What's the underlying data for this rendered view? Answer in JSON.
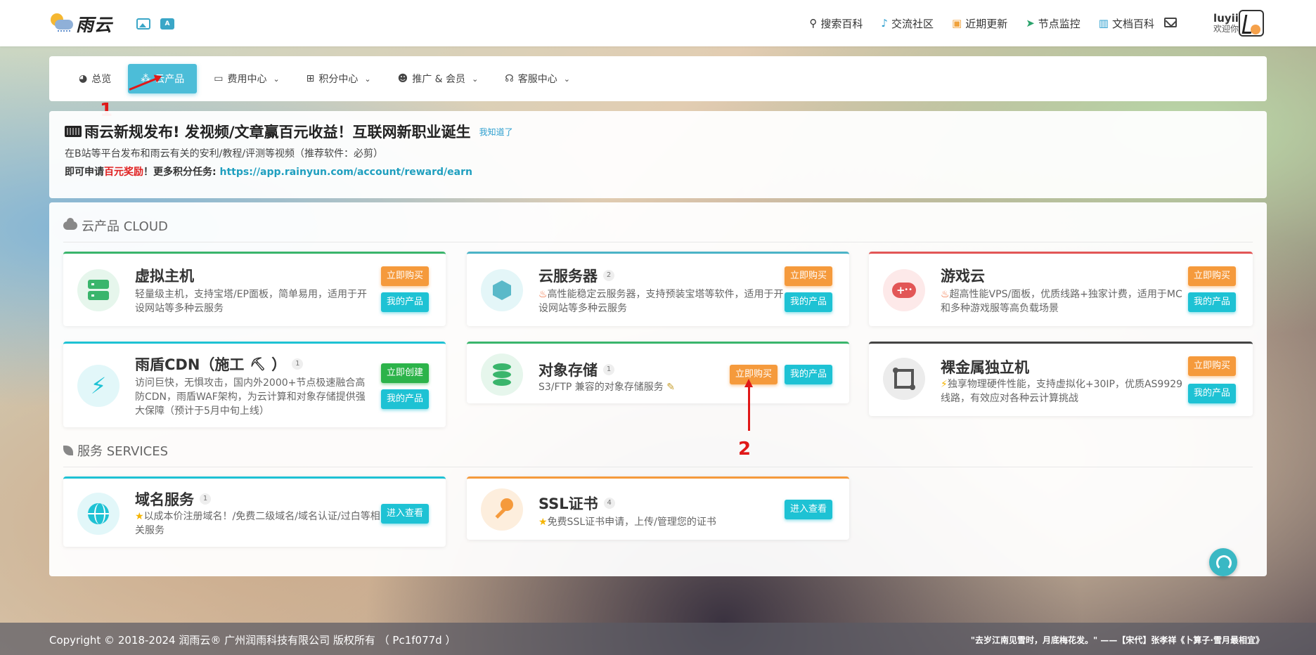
{
  "app": {
    "logo_text": "雨云"
  },
  "topnav": {
    "items": [
      {
        "label": "搜索百科",
        "icon": "search-icon"
      },
      {
        "label": "交流社区",
        "icon": "bell-icon"
      },
      {
        "label": "近期更新",
        "icon": "update-icon"
      },
      {
        "label": "节点监控",
        "icon": "location-arrow-icon"
      },
      {
        "label": "文档百科",
        "icon": "book-icon"
      }
    ],
    "user_name": "luyii",
    "user_greeting": "欢迎你"
  },
  "menu": {
    "items": [
      {
        "label": "总览",
        "icon": "dashboard-icon",
        "active": false
      },
      {
        "label": "云产品",
        "icon": "cubes-icon",
        "active": true
      },
      {
        "label": "费用中心",
        "icon": "money-icon",
        "active": false
      },
      {
        "label": "积分中心",
        "icon": "gift-icon",
        "active": false
      },
      {
        "label": "推广 & 会员",
        "icon": "users-icon",
        "active": false
      },
      {
        "label": "客服中心",
        "icon": "headset-icon",
        "active": false
      }
    ]
  },
  "announcement": {
    "title": "雨云新规发布! 发视频/文章赢百元收益！互联网新职业诞生",
    "link": "我知道了",
    "line1": "在B站等平台发布和雨云有关的安利/教程/评测等视频（推荐软件：必剪）",
    "line2_a": "即可申请",
    "line2_red": "百元奖励",
    "line2_b": "！更多积分任务: ",
    "line2_url": "https://app.rainyun.com/account/reward/earn"
  },
  "sections": {
    "cloud_title": "云产品 CLOUD",
    "services_title": "服务 SERVICES"
  },
  "cards": {
    "vhost": {
      "name": "虚拟主机",
      "desc": "轻量级主机，支持宝塔/EP面板，简单易用，适用于开设网站等多种云服务",
      "btn1": "立即购买",
      "btn2": "我的产品"
    },
    "ecs": {
      "name": "云服务器",
      "badge": "2",
      "desc": "高性能稳定云服务器，支持预装宝塔等软件，适用于开设网站等多种云服务",
      "btn1": "立即购买",
      "btn2": "我的产品"
    },
    "game": {
      "name": "游戏云",
      "desc": "超高性能VPS/面板，优质线路+独家计费，适用于MC和多种游戏服等高负载场景",
      "btn1": "立即购买",
      "btn2": "我的产品"
    },
    "cdn": {
      "name": "雨盾CDN（施工",
      "name_suffix": "）",
      "badge": "1",
      "desc": "访问巨快，无惧攻击，国内外2000+节点极速融合高防CDN，雨盾WAF架构，为云计算和对象存储提供强大保障（预计于5月中旬上线）",
      "btn1": "立即创建",
      "btn2": "我的产品"
    },
    "oss": {
      "name": "对象存储",
      "badge": "1",
      "desc": "S3/FTP 兼容的对象存储服务",
      "btn1": "立即购买",
      "btn2": "我的产品"
    },
    "baremetal": {
      "name": "裸金属独立机",
      "desc": "独享物理硬件性能，支持虚拟化+30IP，优质AS9929线路，有效应对各种云计算挑战",
      "btn1": "立即购买",
      "btn2": "我的产品"
    },
    "domain": {
      "name": "域名服务",
      "badge": "1",
      "desc": "以成本价注册域名！/免费二级域名/域名认证/过白等相关服务",
      "btn": "进入查看"
    },
    "ssl": {
      "name": "SSL证书",
      "badge": "4",
      "desc": "免费SSL证书申请，上传/管理您的证书",
      "btn": "进入查看"
    }
  },
  "annotations": {
    "one": "1",
    "two": "2"
  },
  "footer": {
    "copyright": "Copyright © 2018-2024 润雨云® 广州润雨科技有限公司 版权所有 （ Pc1f077d ）",
    "quote": "\"去岁江南见雪时，月底梅花发。\" ——【宋代】张孝祥《卜算子·雪月最相宜》"
  },
  "colors": {
    "accent": "#4cbdd8",
    "orange": "#f59a3c",
    "cyan": "#1ec2d4",
    "green": "#2cb34a",
    "annotation": "#e01818"
  }
}
